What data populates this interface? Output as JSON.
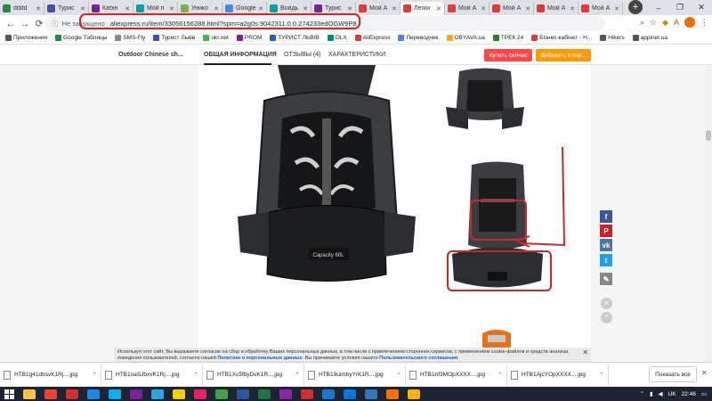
{
  "browser": {
    "tabs": [
      {
        "title": "dddd",
        "color": "#1e8e3e"
      },
      {
        "title": "Турис",
        "color": "#3f51b5"
      },
      {
        "title": "Кабін",
        "color": "#7b1fa2"
      },
      {
        "title": "Мой п",
        "color": "#00a2a2"
      },
      {
        "title": "Унико",
        "color": "#7cb342"
      },
      {
        "title": "Google",
        "color": "#4285f4"
      },
      {
        "title": "Войдь",
        "color": "#00a2a2"
      },
      {
        "title": "Турис",
        "color": "#7b1fa2"
      },
      {
        "title": "Мой А",
        "color": "#e53935"
      },
      {
        "title": "Легки",
        "color": "#e53935"
      },
      {
        "title": "Мой А",
        "color": "#e53935"
      },
      {
        "title": "Мой А",
        "color": "#e53935"
      },
      {
        "title": "Мой А",
        "color": "#e53935"
      },
      {
        "title": "Мой А",
        "color": "#e53935"
      }
    ],
    "active_tab_index": 9,
    "new_tab_glyph": "+",
    "window_controls": [
      "–",
      "❐",
      "✕"
    ],
    "address": {
      "not_secure": "Не защищено",
      "url": "aliexpress.ru/item/33056156288.html?spm=a2g0s.9042311.0.0.274233edOGW9P8"
    },
    "bookmarks": [
      {
        "label": "Приложения",
        "color": "#555"
      },
      {
        "label": "Google Таблицы",
        "color": "#1e8e3e"
      },
      {
        "label": "SMS-Fly",
        "color": "#888"
      },
      {
        "label": "Турист Львів",
        "color": "#3f51b5"
      },
      {
        "label": "ukr.net",
        "color": "#4caf50"
      },
      {
        "label": "PROM",
        "color": "#7b1fa2"
      },
      {
        "label": "ТУРИСТ ЛЬВІВ",
        "color": "#1565c0"
      },
      {
        "label": "OLX",
        "color": "#00897b"
      },
      {
        "label": "AliExpress",
        "color": "#e53935"
      },
      {
        "label": "Переводчик",
        "color": "#4285f4"
      },
      {
        "label": "OBYAVA.ua",
        "color": "#f9a825"
      },
      {
        "label": "ТРЕК 24",
        "color": "#2e7d32"
      },
      {
        "label": "Бізнес-кабінет - Н...",
        "color": "#e53935"
      },
      {
        "label": "Hikers",
        "color": "#555"
      },
      {
        "label": "appinet.ua",
        "color": "#555"
      }
    ]
  },
  "page": {
    "product_name": "Outdoor Chinese sh...",
    "tabs": [
      "ОБЩАЯ ИНФОРМАЦИЯ",
      "ОТЗЫВЫ (4)",
      "ХАРАКТЕРИСТИКИ"
    ],
    "buy_now": "Купить сейчас",
    "add_to_cart": "Добавить в кор...",
    "backpack_label": "Capacity 60L",
    "social": [
      {
        "name": "facebook",
        "glyph": "f",
        "color": "#3b5998"
      },
      {
        "name": "pinterest",
        "glyph": "P",
        "color": "#cb2027"
      },
      {
        "name": "vk",
        "glyph": "vk",
        "color": "#4c75a3"
      },
      {
        "name": "twitter",
        "glyph": "t",
        "color": "#1da1f2"
      },
      {
        "name": "edit",
        "glyph": "✎",
        "color": "#888"
      }
    ],
    "colors": {
      "buy": "#ff4747",
      "cart": "#ff9a00",
      "annotation": "#c9282d"
    }
  },
  "cookie": {
    "text": "Используя этот сайт, Вы выражаете согласие на сбор и обработку Ваших персональных данных, в том числе с привлечением сторонних сервисов, с применением cookie-файлов и средств анализа поведения пользователей, согласно нашей ",
    "policy_link": "Политике о персональных данных",
    "middle": ". Вы принимаете условия нашего ",
    "agreement_link": "Пользовательского соглашения",
    "end": "."
  },
  "downloads": {
    "items": [
      "HTB1g41dbsvK1Rj....jpg",
      "HTB1oaSJbxvK1Rj....jpg",
      "HTB1Xc5fbyDvK1R....jpg",
      "HTB19uimbyYrK1R....jpg",
      "HTB1nf3MOpXXXX....jpg",
      "HTB1AjcYOpXXXX....jpg"
    ],
    "show_all": "Показать все"
  },
  "taskbar": {
    "lang": "UK",
    "time": "22:46",
    "apps": [
      {
        "name": "explorer",
        "color": "#f6c343"
      },
      {
        "name": "chrome",
        "color": "#ea4335"
      },
      {
        "name": "opera",
        "color": "#d32f2f"
      },
      {
        "name": "ie",
        "color": "#1e88e5"
      },
      {
        "name": "skype",
        "color": "#00aff0"
      },
      {
        "name": "viber",
        "color": "#7b1fa2"
      },
      {
        "name": "telegram",
        "color": "#2ca5e0"
      },
      {
        "name": "yandex",
        "color": "#ffcc00"
      },
      {
        "name": "paint",
        "color": "#e91e63"
      },
      {
        "name": "photos",
        "color": "#43a047"
      },
      {
        "name": "word",
        "color": "#2b579a"
      },
      {
        "name": "excel",
        "color": "#217346"
      },
      {
        "name": "winrar",
        "color": "#8e24aa"
      },
      {
        "name": "acrobat",
        "color": "#d32f2f"
      },
      {
        "name": "mail",
        "color": "#1976d2"
      },
      {
        "name": "store",
        "color": "#0078d7"
      },
      {
        "name": "edge",
        "color": "#3277bc"
      },
      {
        "name": "media",
        "color": "#ff6f00"
      },
      {
        "name": "folder",
        "color": "#ffb300"
      }
    ]
  }
}
